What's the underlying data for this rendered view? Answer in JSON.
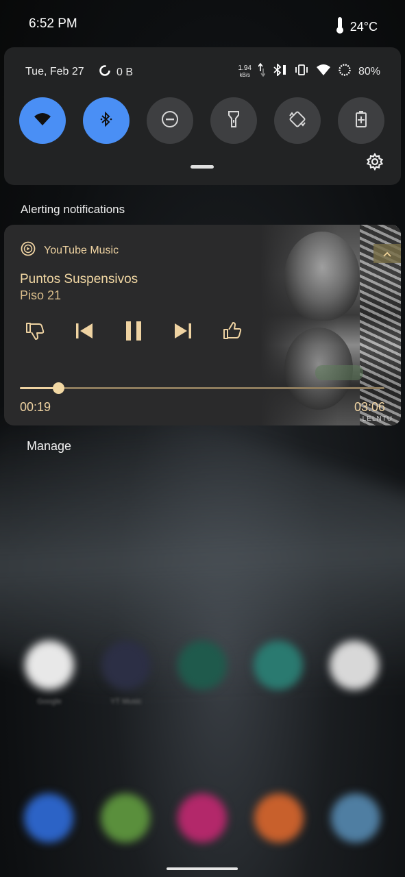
{
  "status_bar": {
    "time": "6:52 PM",
    "temperature": "24°C"
  },
  "quick_settings": {
    "date": "Tue, Feb 27",
    "data_usage": "0 B",
    "net_speed_value": "1.94",
    "net_speed_unit": "kB/s",
    "battery": "80%",
    "tiles": [
      {
        "name": "wifi",
        "icon": "wifi-icon",
        "active": true
      },
      {
        "name": "bluetooth",
        "icon": "bluetooth-icon",
        "active": true
      },
      {
        "name": "do-not-disturb",
        "icon": "dnd-icon",
        "active": false
      },
      {
        "name": "flashlight",
        "icon": "flashlight-icon",
        "active": false
      },
      {
        "name": "auto-rotate",
        "icon": "rotate-icon",
        "active": false
      },
      {
        "name": "battery-saver",
        "icon": "battery-saver-icon",
        "active": false
      }
    ]
  },
  "notifications": {
    "section_title": "Alerting notifications",
    "media": {
      "app_name": "YouTube Music",
      "song_title": "Puntos Suspensivos",
      "artist": "Piso 21",
      "elapsed": "00:19",
      "duration": "03:06",
      "progress": 0.105,
      "accent_color": "#efd3a2",
      "art_watermark": "LELNTU"
    },
    "manage_label": "Manage"
  },
  "colors": {
    "tile_active": "#4a8ff5",
    "tile_inactive": "#3e3f41",
    "panel": "#222324"
  }
}
